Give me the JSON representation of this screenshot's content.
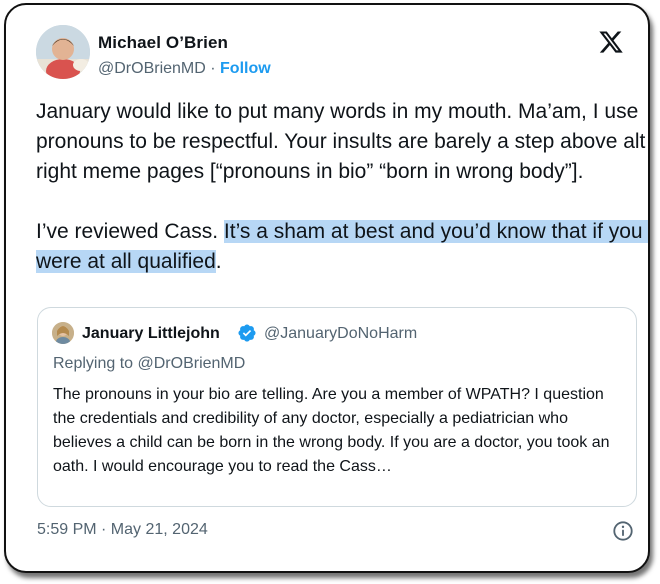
{
  "author": {
    "name": "Michael O’Brien",
    "handle": "@DrOBrienMD",
    "separator": " · ",
    "follow_label": "Follow"
  },
  "tweet": {
    "text_before_highlight": "January would like to put many words in my mouth. Ma’am, I use pronouns to be respectful. Your insults are barely a step above alt right meme pages [“pronouns in bio” “born in wrong body”].\n\nI’ve reviewed Cass. ",
    "text_highlighted": "It’s a sham at best and you’d know that if you were at all qualified",
    "text_after_highlight": "."
  },
  "quoted_tweet": {
    "name": "January Littlejohn",
    "handle": "@JanuaryDoNoHarm",
    "replying_to": "Replying to @DrOBrienMD",
    "text": "The pronouns in your bio are telling. Are you a member of WPATH? I question the credentials and credibility of any doctor, especially a pediatrician who believes a child can be born in the wrong body. If you are a doctor, you took an oath. I would encourage you to read the Cass…"
  },
  "timestamp": "5:59 PM · May 21, 2024",
  "colors": {
    "accent": "#1d9bf0",
    "secondary_text": "#536471",
    "highlight": "#b7d7f5"
  },
  "icons": {
    "brand": "x-logo-icon",
    "verified": "verified-badge-icon",
    "info": "info-icon"
  }
}
